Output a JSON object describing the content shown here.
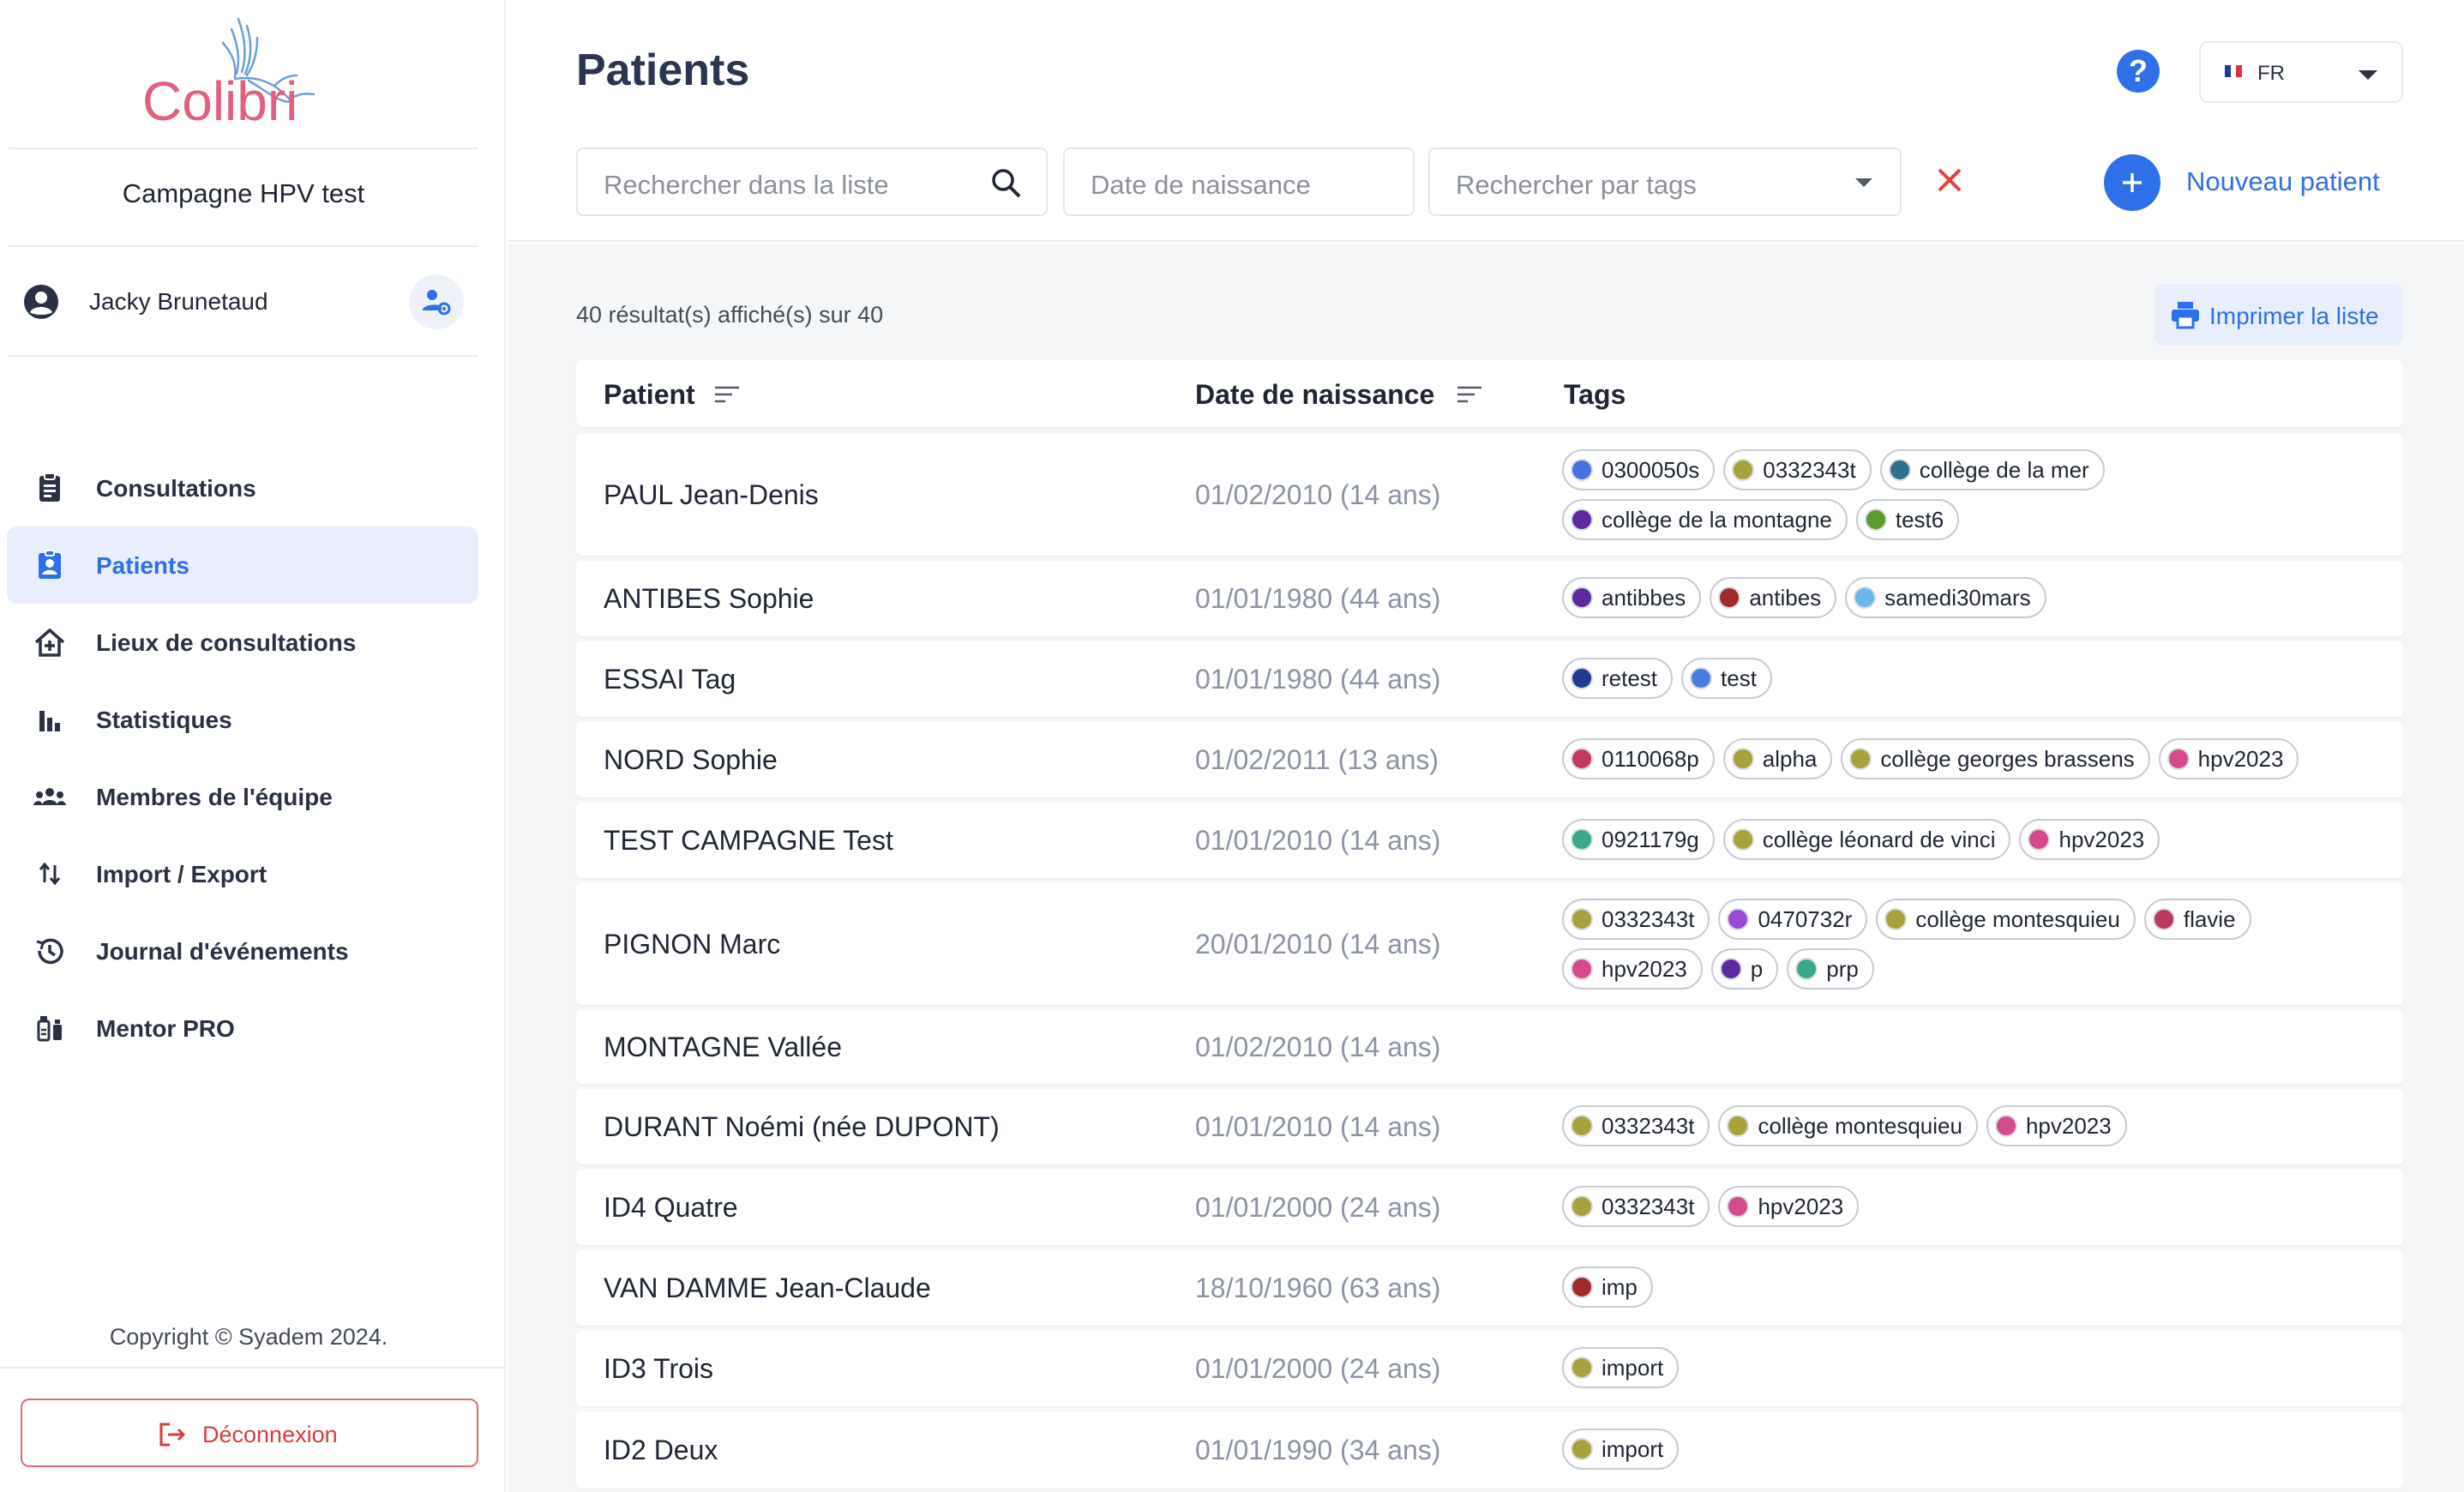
{
  "sidebar": {
    "logo_text": "Colibri",
    "campaign": "Campagne HPV test",
    "user_name": "Jacky Brunetaud",
    "nav": [
      {
        "label": "Consultations",
        "icon": "clipboard-icon",
        "active": false
      },
      {
        "label": "Patients",
        "icon": "patient-badge-icon",
        "active": true
      },
      {
        "label": "Lieux de consultations",
        "icon": "home-plus-icon",
        "active": false
      },
      {
        "label": "Statistiques",
        "icon": "bar-chart-icon",
        "active": false
      },
      {
        "label": "Membres de l'équipe",
        "icon": "team-icon",
        "active": false
      },
      {
        "label": "Import / Export",
        "icon": "swap-vertical-icon",
        "active": false
      },
      {
        "label": "Journal d'événements",
        "icon": "history-icon",
        "active": false
      },
      {
        "label": "Mentor PRO",
        "icon": "vaccine-icon",
        "active": false
      }
    ],
    "copyright": "Copyright © Syadem 2024.",
    "logout": "Déconnexion"
  },
  "header": {
    "title": "Patients",
    "lang": "FR",
    "search_placeholder": "Rechercher dans la liste",
    "birth_placeholder": "Date de naissance",
    "tags_placeholder": "Rechercher par tags",
    "new_patient": "Nouveau patient"
  },
  "content": {
    "result_count": "40 résultat(s) affiché(s) sur 40",
    "print_label": "Imprimer la liste",
    "columns": [
      "Patient",
      "Date de naissance",
      "Tags"
    ],
    "rows": [
      {
        "patient": "PAUL Jean-Denis",
        "birth": "01/02/2010 (14 ans)",
        "tags": [
          {
            "label": "0300050s",
            "color": "#4a6fe0"
          },
          {
            "label": "0332343t",
            "color": "#a8a23a"
          },
          {
            "label": "collège de la mer",
            "color": "#2f6f8e"
          },
          {
            "label": "collège de la montagne",
            "color": "#5b2a9e"
          },
          {
            "label": "test6",
            "color": "#5a9a2e"
          }
        ]
      },
      {
        "patient": "ANTIBES Sophie",
        "birth": "01/01/1980 (44 ans)",
        "tags": [
          {
            "label": "antibbes",
            "color": "#5b2a9e"
          },
          {
            "label": "antibes",
            "color": "#9e2a2a"
          },
          {
            "label": "samedi30mars",
            "color": "#6ab8e8"
          }
        ]
      },
      {
        "patient": "ESSAI Tag",
        "birth": "01/01/1980 (44 ans)",
        "tags": [
          {
            "label": "retest",
            "color": "#1f3a8e"
          },
          {
            "label": "test",
            "color": "#4a7be0"
          }
        ]
      },
      {
        "patient": "NORD Sophie",
        "birth": "01/02/2011 (13 ans)",
        "tags": [
          {
            "label": "0110068p",
            "color": "#c43a5e"
          },
          {
            "label": "alpha",
            "color": "#a8a23a"
          },
          {
            "label": "collège georges brassens",
            "color": "#a8a23a"
          },
          {
            "label": "hpv2023",
            "color": "#d44a8a"
          }
        ]
      },
      {
        "patient": "TEST CAMPAGNE Test",
        "birth": "01/01/2010 (14 ans)",
        "tags": [
          {
            "label": "0921179g",
            "color": "#3aa88a"
          },
          {
            "label": "collège léonard de vinci",
            "color": "#a8a23a"
          },
          {
            "label": "hpv2023",
            "color": "#d44a8a"
          }
        ]
      },
      {
        "patient": "PIGNON Marc",
        "birth": "20/01/2010 (14 ans)",
        "tags": [
          {
            "label": "0332343t",
            "color": "#a8a23a"
          },
          {
            "label": "0470732r",
            "color": "#9a4ad8"
          },
          {
            "label": "collège montesquieu",
            "color": "#a8a23a"
          },
          {
            "label": "flavie",
            "color": "#b83a5e"
          },
          {
            "label": "hpv2023",
            "color": "#d44a8a"
          },
          {
            "label": "p",
            "color": "#5b2a9e"
          },
          {
            "label": "prp",
            "color": "#3aa88a"
          }
        ]
      },
      {
        "patient": "MONTAGNE Vallée",
        "birth": "01/02/2010 (14 ans)",
        "tags": []
      },
      {
        "patient": "DURANT Noémi (née DUPONT)",
        "birth": "01/01/2010 (14 ans)",
        "tags": [
          {
            "label": "0332343t",
            "color": "#a8a23a"
          },
          {
            "label": "collège montesquieu",
            "color": "#a8a23a"
          },
          {
            "label": "hpv2023",
            "color": "#d44a8a"
          }
        ]
      },
      {
        "patient": "ID4 Quatre",
        "birth": "01/01/2000 (24 ans)",
        "tags": [
          {
            "label": "0332343t",
            "color": "#a8a23a"
          },
          {
            "label": "hpv2023",
            "color": "#d44a8a"
          }
        ]
      },
      {
        "patient": "VAN DAMME Jean-Claude",
        "birth": "18/10/1960 (63 ans)",
        "tags": [
          {
            "label": "imp",
            "color": "#9e2a2a"
          }
        ]
      },
      {
        "patient": "ID3 Trois",
        "birth": "01/01/2000 (24 ans)",
        "tags": [
          {
            "label": "import",
            "color": "#a8a23a"
          }
        ]
      },
      {
        "patient": "ID2 Deux",
        "birth": "01/01/1990 (34 ans)",
        "tags": [
          {
            "label": "import",
            "color": "#a8a23a"
          }
        ]
      }
    ]
  },
  "colors": {
    "accent": "#2f6fe8",
    "danger": "#e0443e",
    "logo_pink": "#e0607e",
    "logo_blue": "#6b9fd6"
  }
}
